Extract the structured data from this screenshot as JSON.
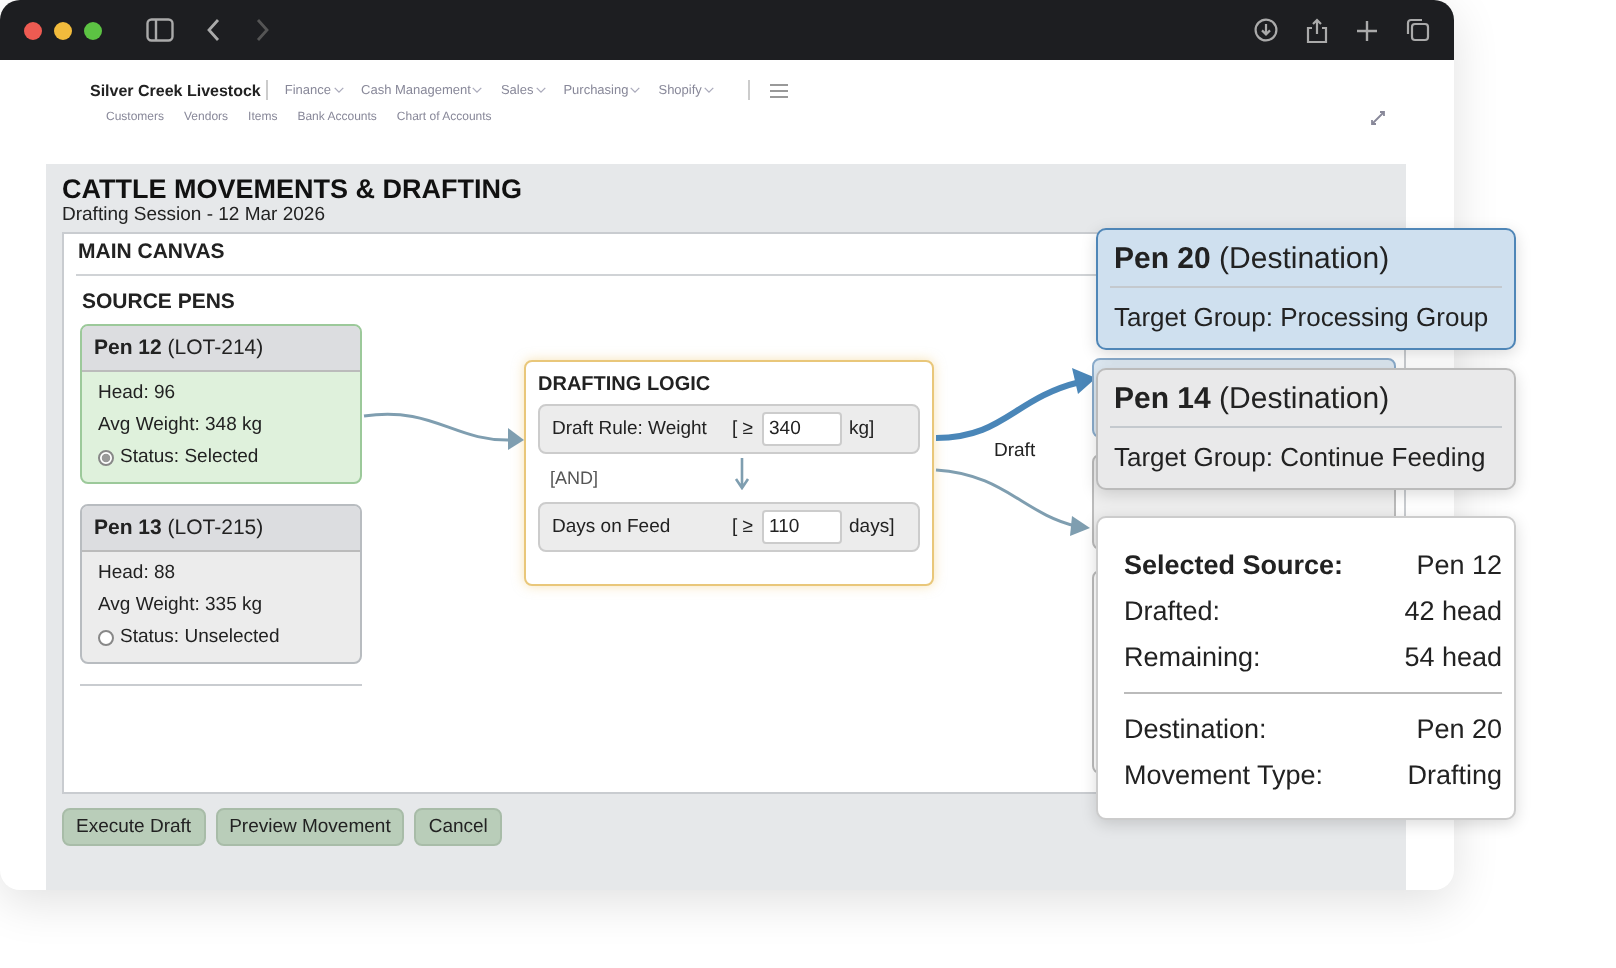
{
  "app": {
    "brand": "Silver Creek Livestock",
    "menus": [
      {
        "label": "Finance"
      },
      {
        "label": "Cash Management"
      },
      {
        "label": "Sales"
      },
      {
        "label": "Purchasing"
      },
      {
        "label": "Shopify"
      }
    ],
    "links": [
      "Customers",
      "Vendors",
      "Items",
      "Bank Accounts",
      "Chart of Accounts"
    ]
  },
  "page": {
    "title": "CATTLE MOVEMENTS & DRAFTING",
    "subtitle": "Drafting Session - 12 Mar 2026"
  },
  "canvas": {
    "title": "MAIN CANVAS",
    "section": "SOURCE PENS",
    "source_pens": [
      {
        "name": "Pen 12",
        "lot": "(LOT-214)",
        "head": "Head: 96",
        "weight": "Avg Weight: 348 kg",
        "status": "Status: Selected",
        "selected": true
      },
      {
        "name": "Pen 13",
        "lot": "(LOT-215)",
        "head": "Head: 88",
        "weight": "Avg Weight: 335 kg",
        "status": "Status: Unselected",
        "selected": false
      }
    ],
    "logic": {
      "title": "DRAFTING LOGIC",
      "joiner": "[AND]",
      "rules": [
        {
          "label": "Draft Rule: Weight",
          "open": "[ ≥",
          "value": "340",
          "close": "kg]"
        },
        {
          "label": "Days on Feed",
          "open": "[ ≥",
          "value": "110",
          "close": "days]"
        }
      ]
    },
    "connector_label": "Draft"
  },
  "destinations": [
    {
      "name": "Pen 20",
      "role": "(Destination)",
      "target": "Target Group: Processing Group",
      "selected": true
    },
    {
      "name": "Pen 14",
      "role": "(Destination)",
      "target": "Target Group: Continue Feeding",
      "selected": false
    }
  ],
  "summary": {
    "sections": [
      [
        {
          "label": "Selected Source:",
          "value": "Pen 12",
          "emphasis": true
        },
        {
          "label": "Drafted:",
          "value": "42 head",
          "emphasis": false
        },
        {
          "label": "Remaining:",
          "value": "54 head",
          "emphasis": false
        }
      ],
      [
        {
          "label": "Destination:",
          "value": "Pen 20",
          "emphasis": false
        },
        {
          "label": "Movement Type:",
          "value": "Drafting",
          "emphasis": false
        }
      ]
    ]
  },
  "buttons": [
    "Execute Draft",
    "Preview Movement",
    "Cancel"
  ]
}
